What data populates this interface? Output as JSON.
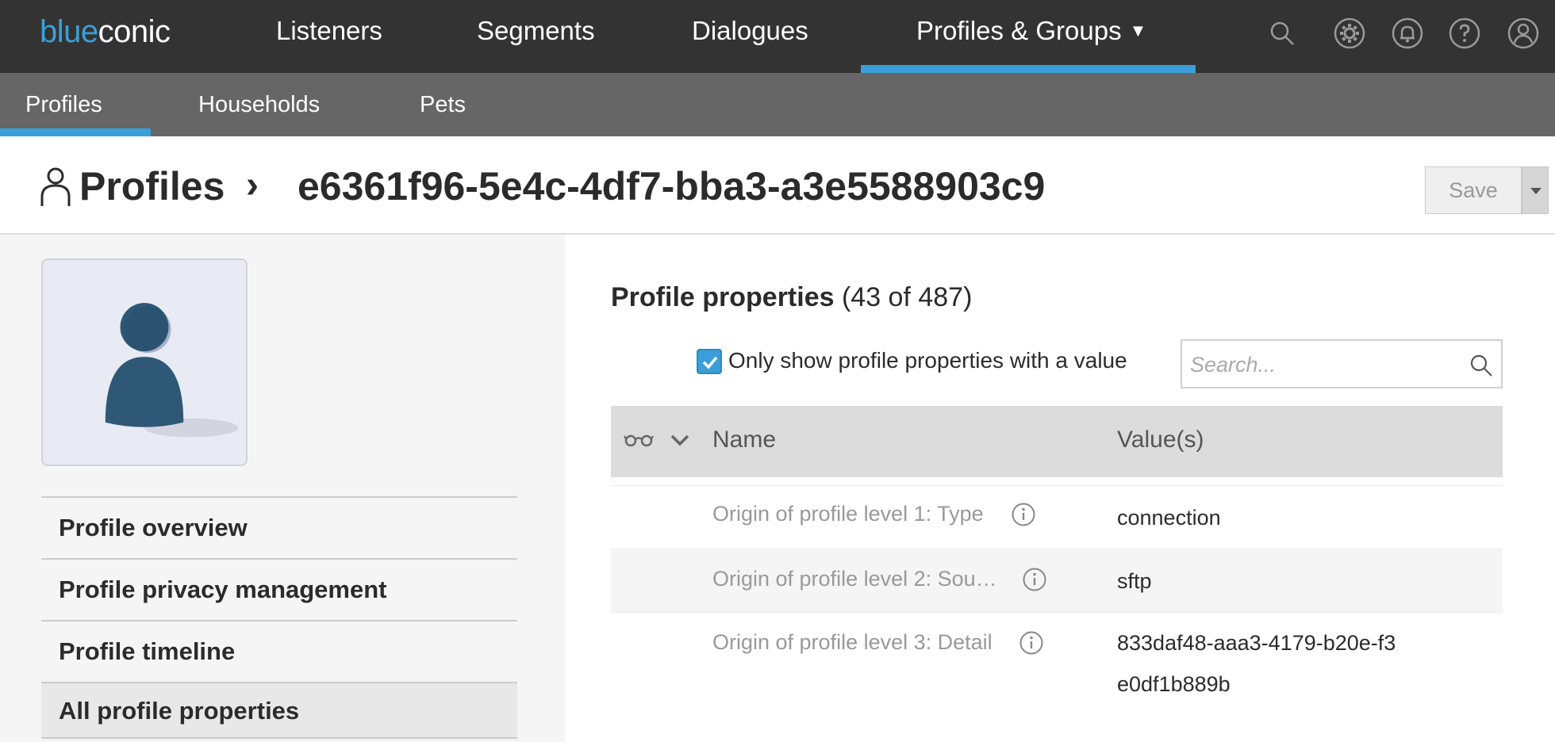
{
  "brand": {
    "logo_part1": "blue",
    "logo_part2": "conic",
    "accent": "#3a9fd8"
  },
  "topnav": {
    "items": [
      {
        "label": "Listeners"
      },
      {
        "label": "Segments"
      },
      {
        "label": "Dialogues"
      },
      {
        "label": "Profiles & Groups",
        "caret": "▼"
      }
    ],
    "icons": [
      "search-icon",
      "settings-icon",
      "notifications-icon",
      "help-icon",
      "user-account-icon"
    ]
  },
  "subnav": {
    "items": [
      {
        "label": "Profiles"
      },
      {
        "label": "Households"
      },
      {
        "label": "Pets"
      }
    ]
  },
  "header": {
    "breadcrumb_root": "Profiles",
    "breadcrumb_separator": "›",
    "profile_id": "e6361f96-5e4c-4df7-bba3-a3e5588903c9",
    "save_label": "Save"
  },
  "left_menu": {
    "items": [
      {
        "label": "Profile overview"
      },
      {
        "label": "Profile privacy management"
      },
      {
        "label": "Profile timeline"
      },
      {
        "label": "All profile properties"
      }
    ]
  },
  "properties": {
    "title": "Profile properties",
    "count": "(43 of 487)",
    "filter_label": "Only show profile properties with a value",
    "filter_checked": true,
    "search_placeholder": "Search...",
    "columns": {
      "name": "Name",
      "value": "Value(s)"
    },
    "rows": [
      {
        "name": "Origin of profile level 1: Type",
        "value": "connection"
      },
      {
        "name": "Origin of profile level 2: Sou…",
        "value": "sftp"
      },
      {
        "name": "Origin of profile level 3: Detail",
        "value": "833daf48-aaa3-4179-b20e-f3e0df1b889b"
      }
    ]
  }
}
